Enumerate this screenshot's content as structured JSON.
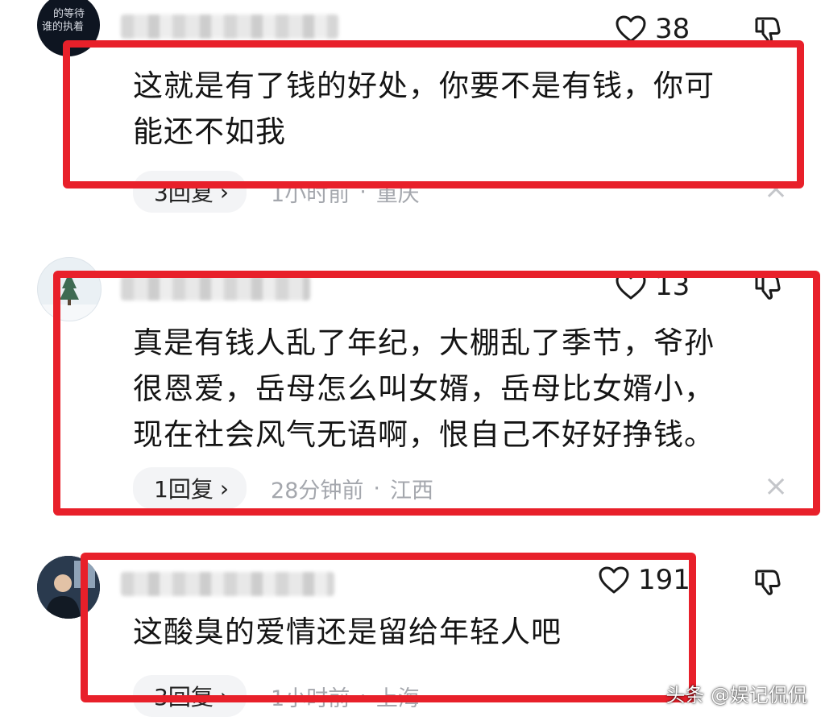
{
  "comments": [
    {
      "likes": "38",
      "text_lines": [
        "这就是有了钱的好处，你要不是有钱，你可",
        "能还不如我"
      ],
      "replies": "3回复",
      "time": "1小时前",
      "location": "重庆",
      "avatar_caption": [
        "的等待",
        "谁的执着"
      ]
    },
    {
      "likes": "13",
      "text_lines": [
        "真是有钱人乱了年纪，大棚乱了季节，爷孙",
        "很恩爱，岳母怎么叫女婿，岳母比女婿小，",
        "现在社会风气无语啊，恨自己不好好挣钱。"
      ],
      "replies": "1回复",
      "time": "28分钟前",
      "location": "江西"
    },
    {
      "likes": "191",
      "text_lines": [
        "这酸臭的爱情还是留给年轻人吧"
      ],
      "replies": "3回复",
      "time": "1小时前",
      "location": "上海"
    }
  ],
  "meta_separator": "·",
  "reply_chevron": "›",
  "close_glyph": "×",
  "watermark": "头条 @娱记侃侃",
  "colors": {
    "highlight_box": "#e8202a",
    "meta_gray": "#a4a7ad",
    "pill_bg": "#f3f4f6"
  },
  "icons": {
    "like": "heart-outline-icon",
    "dislike": "thumbs-down-icon",
    "dismiss": "close-icon"
  }
}
